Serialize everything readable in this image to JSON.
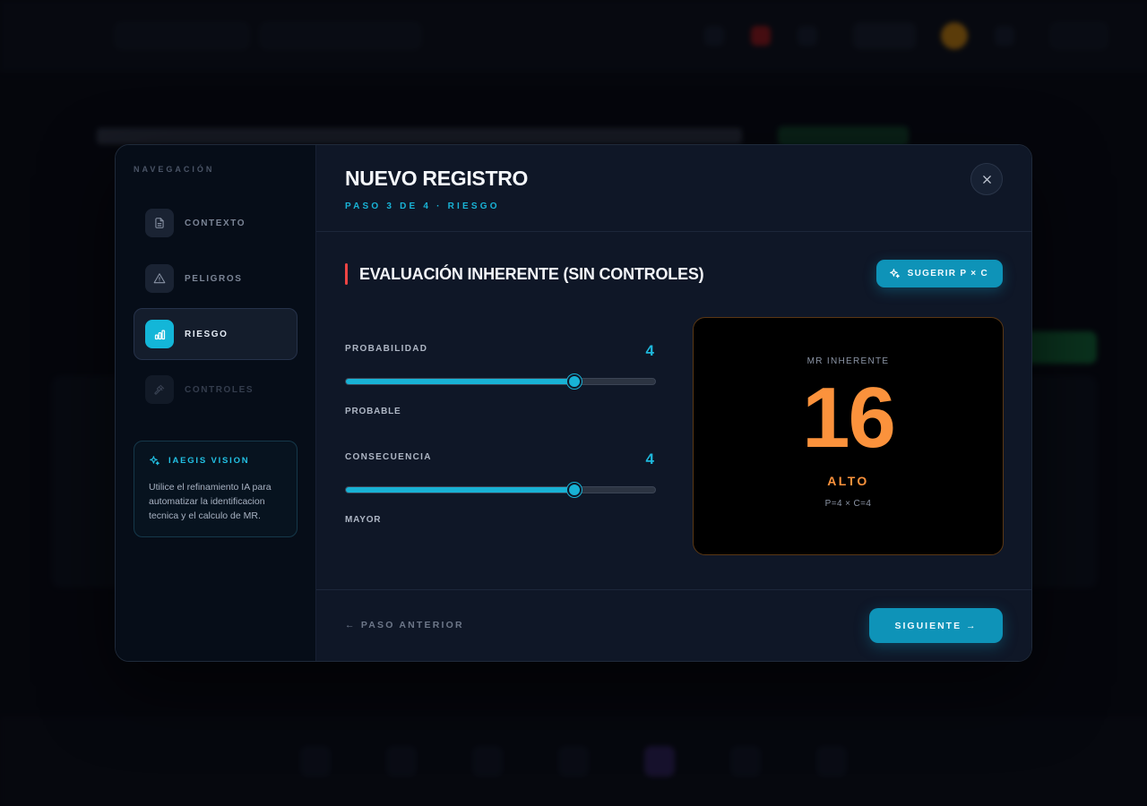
{
  "modal": {
    "title": "NUEVO REGISTRO",
    "step": "PASO 3 DE 4 · RIESGO"
  },
  "sidebar": {
    "heading": "NAVEGACIÓN",
    "items": [
      {
        "label": "CONTEXTO",
        "icon": "document-icon",
        "state": "done"
      },
      {
        "label": "PELIGROS",
        "icon": "warning-icon",
        "state": "done"
      },
      {
        "label": "RIESGO",
        "icon": "bar-chart-icon",
        "state": "active"
      },
      {
        "label": "CONTROLES",
        "icon": "gavel-icon",
        "state": "disabled"
      }
    ],
    "vision": {
      "title": "IAEGIS VISION",
      "text": "Utilice el refinamiento IA para automatizar la identificacion tecnica y el calculo de MR."
    }
  },
  "section": {
    "title": "EVALUACIÓN INHERENTE (SIN CONTROLES)",
    "suggest_label": "SUGERIR P × C"
  },
  "sliders": [
    {
      "label": "PROBABILIDAD",
      "value": "4",
      "fraction": 0.74,
      "description": "PROBABLE"
    },
    {
      "label": "CONSECUENCIA",
      "value": "4",
      "fraction": 0.74,
      "description": "MAYOR"
    }
  ],
  "mr": {
    "label": "MR INHERENTE",
    "score": "16",
    "level": "ALTO",
    "formula": "P=4 × C=4"
  },
  "footer": {
    "prev_label": "← PASO ANTERIOR",
    "next_label": "SIGUIENTE →"
  },
  "colors": {
    "accent": "#18b2d5",
    "risk_high": "#fb923c",
    "section_bar": "#ef4444"
  }
}
